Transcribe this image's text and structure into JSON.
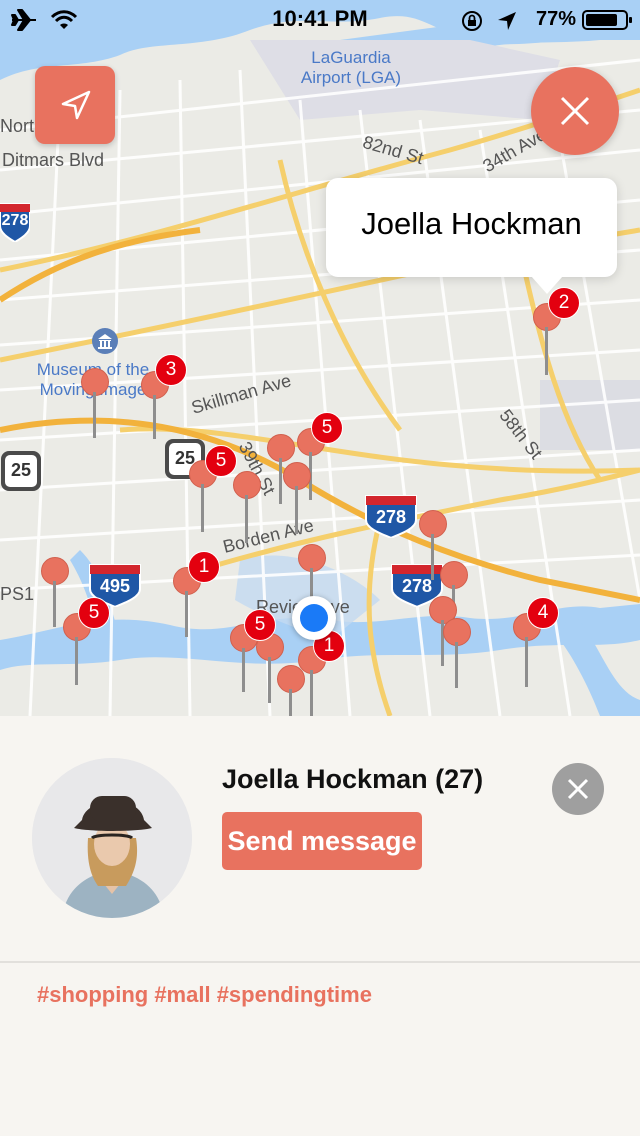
{
  "status_bar": {
    "time": "10:41 PM",
    "battery": "77%"
  },
  "map": {
    "labels": {
      "airport": "LaGuardia\nAirport (LGA)",
      "museum": "Museum of the\nMoving Image",
      "ditmars": "Ditmars Blvd",
      "st82": "82nd St",
      "av34": "34th Ave",
      "skillman": "Skillman Ave",
      "st39": "39th St",
      "borden": "Borden Ave",
      "review": "Review Ave",
      "st58": "58th St",
      "north": "North",
      "ps1": "PS1"
    },
    "shields": {
      "i278_left": "278",
      "i278_mid": "278",
      "i278_low": "278",
      "i495": "495",
      "r25_left": "25",
      "r25_mid": "25"
    },
    "callout_name": "Joella Hockman",
    "badges": [
      "2",
      "3",
      "5",
      "5",
      "1",
      "5",
      "5",
      "1",
      "4"
    ]
  },
  "profile": {
    "name": "Joella Hockman (27)",
    "send_label": "Send message",
    "tags": "#shopping #mall #spendingtime"
  },
  "colors": {
    "accent": "#e8725f",
    "badge": "#e3000f",
    "user_dot": "#1a7af7"
  }
}
